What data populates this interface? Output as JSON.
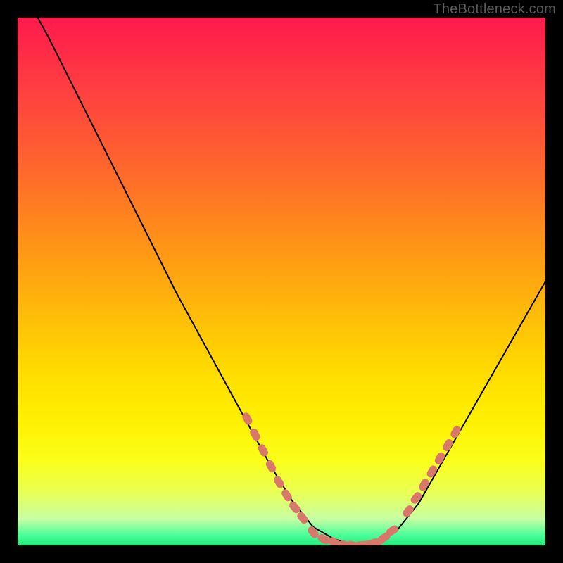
{
  "watermark": "TheBottleneck.com",
  "chart_data": {
    "type": "line",
    "title": "",
    "xlabel": "",
    "ylabel": "",
    "xlim": [
      0,
      100
    ],
    "ylim": [
      0,
      100
    ],
    "grid": false,
    "series": [
      {
        "name": "bottleneck-curve",
        "x": [
          0,
          6,
          12,
          18,
          24,
          30,
          36,
          42,
          48,
          52,
          56,
          60,
          64,
          68,
          72,
          76,
          80,
          84,
          88,
          92,
          96,
          100
        ],
        "values": [
          107,
          96,
          84,
          72,
          60,
          48,
          37,
          26,
          15,
          8.5,
          3.5,
          1.2,
          0,
          0.5,
          3,
          8,
          15,
          22,
          29,
          36,
          43,
          50
        ],
        "stroke": "#000000",
        "stroke_width": 2
      }
    ],
    "markers": [
      {
        "name": "left-flank-dots",
        "shape": "rounded-dot",
        "color": "#d9776a",
        "points_x": [
          43.5,
          45.0,
          46.5,
          48.0,
          49.5,
          51.0,
          52.5,
          54.0
        ],
        "points_value": [
          24.0,
          21.0,
          18.0,
          15.0,
          12.0,
          9.5,
          7.2,
          5.2
        ]
      },
      {
        "name": "trough-dots",
        "shape": "rounded-dot",
        "color": "#d9776a",
        "points_x": [
          56.0,
          58.0,
          60.0,
          62.0,
          63.5,
          65.0,
          66.5,
          68.0,
          69.5,
          71.0
        ],
        "points_value": [
          2.5,
          1.2,
          0.6,
          0.1,
          0.0,
          0.05,
          0.2,
          0.6,
          1.5,
          2.8
        ]
      },
      {
        "name": "right-flank-dots",
        "shape": "rounded-dot",
        "color": "#d9776a",
        "points_x": [
          74.0,
          75.5,
          77.0,
          78.5,
          80.0,
          81.5,
          83.0
        ],
        "points_value": [
          6.5,
          9.0,
          11.5,
          14.0,
          16.5,
          19.0,
          21.5
        ]
      }
    ],
    "gradient_stops": [
      {
        "pos": 0.0,
        "color": "#ff1a4d"
      },
      {
        "pos": 0.35,
        "color": "#ff9a14"
      },
      {
        "pos": 0.66,
        "color": "#ffd900"
      },
      {
        "pos": 0.9,
        "color": "#e8ff55"
      },
      {
        "pos": 1.0,
        "color": "#20e87a"
      }
    ]
  }
}
